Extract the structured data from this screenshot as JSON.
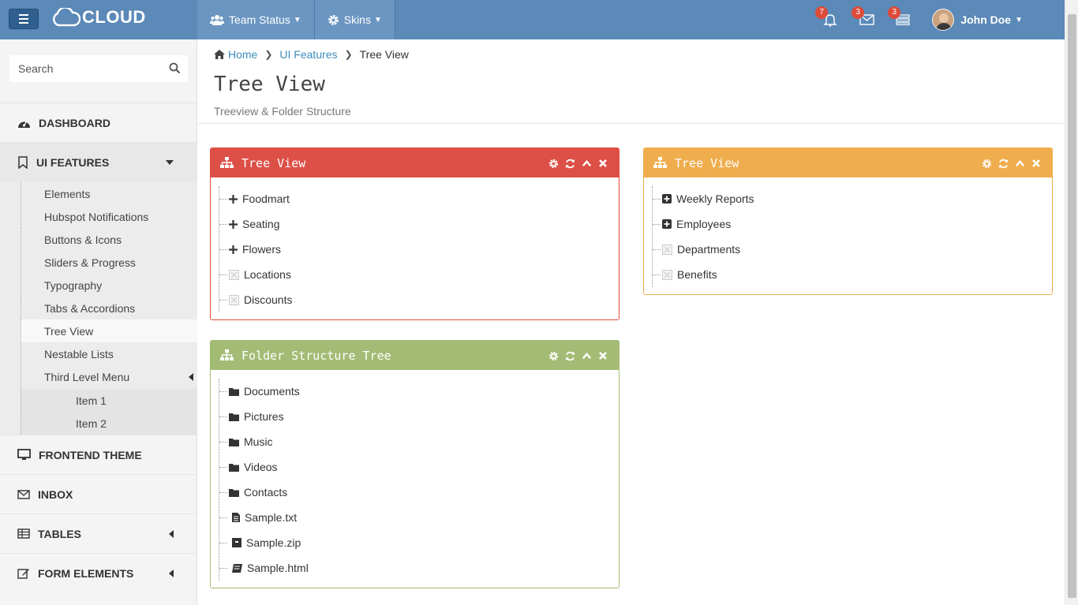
{
  "brand": {
    "logo_text": "CLOUD"
  },
  "top_nav": [
    {
      "label": "Team Status",
      "icon": "users-icon"
    },
    {
      "label": "Skins",
      "icon": "gear-icon"
    }
  ],
  "notifications": {
    "alerts": "7",
    "messages": "3",
    "tasks": "3"
  },
  "user": {
    "name": "John Doe"
  },
  "sidebar": {
    "search_placeholder": "Search",
    "items": [
      {
        "label": "DASHBOARD",
        "icon": "dashboard-icon"
      },
      {
        "label": "UI FEATURES",
        "icon": "bookmark-icon"
      },
      {
        "label": "FRONTEND THEME",
        "icon": "desktop-icon"
      },
      {
        "label": "INBOX",
        "icon": "envelope-icon"
      },
      {
        "label": "TABLES",
        "icon": "table-icon"
      },
      {
        "label": "FORM ELEMENTS",
        "icon": "edit-icon"
      }
    ],
    "submenu": [
      "Elements",
      "Hubspot Notifications",
      "Buttons & Icons",
      "Sliders & Progress",
      "Typography",
      "Tabs & Accordions",
      "Tree View",
      "Nestable Lists",
      "Third Level Menu"
    ],
    "third_level": [
      "Item 1",
      "Item 2"
    ]
  },
  "breadcrumb": {
    "home": "Home",
    "section": "UI Features",
    "current": "Tree View"
  },
  "page": {
    "title": "Tree View",
    "subtitle": "Treeview & Folder Structure"
  },
  "panels": {
    "tree_red": {
      "title": "Tree View",
      "nodes": [
        "Foodmart",
        "Seating",
        "Flowers",
        "Locations",
        "Discounts"
      ]
    },
    "tree_yellow": {
      "title": "Tree View",
      "nodes": [
        "Weekly Reports",
        "Employees",
        "Departments",
        "Benefits"
      ]
    },
    "folder_tree": {
      "title": "Folder Structure Tree",
      "nodes": [
        "Documents",
        "Pictures",
        "Music",
        "Videos",
        "Contacts",
        "Sample.txt",
        "Sample.zip",
        "Sample.html"
      ]
    }
  },
  "colors": {
    "topbar": "#5b89b8",
    "red_panel": "#dd5047",
    "yellow_panel": "#f0ad4e",
    "green_panel": "#a3bb74",
    "link": "#3c8dbc"
  }
}
